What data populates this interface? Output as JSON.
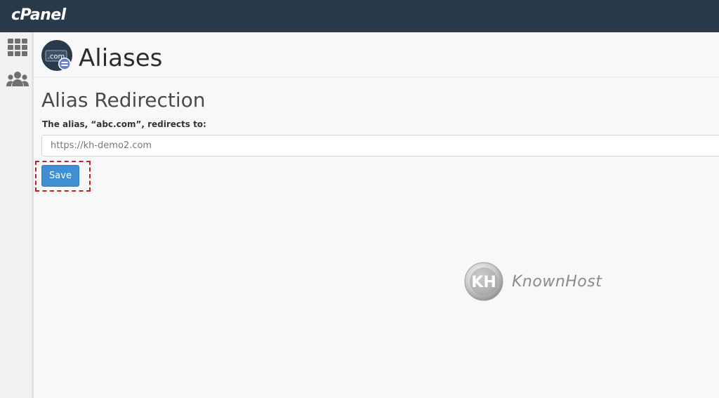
{
  "header": {
    "logo_text": "cPanel"
  },
  "sidebar": {
    "icons": [
      {
        "name": "apps-grid-icon"
      },
      {
        "name": "users-icon"
      }
    ]
  },
  "page": {
    "title": "Aliases",
    "app_icon_text": ".com"
  },
  "form": {
    "section_title": "Alias Redirection",
    "label": "The alias, “abc.com”, redirects to:",
    "redirect_value": "https://kh-demo2.com",
    "save_label": "Save"
  },
  "watermark": {
    "monogram": "KH",
    "text": "KnownHost"
  },
  "colors": {
    "topbar": "#293a4a",
    "button": "#3f8fd2",
    "highlight": "#c41f2a"
  }
}
